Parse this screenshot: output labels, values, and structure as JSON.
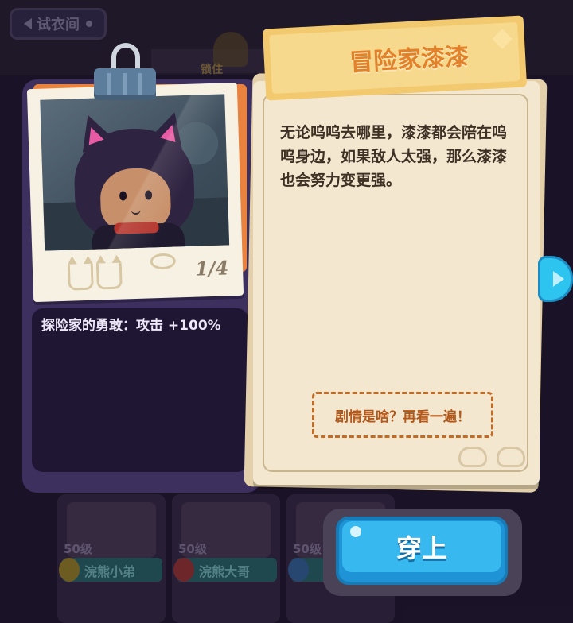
{
  "top": {
    "tryon_label": "试衣间",
    "locked_label": "锁住"
  },
  "card": {
    "name": "冒险家漆漆",
    "page": "1/4",
    "skill": "探险家的勇敢：攻击 +100%",
    "story": "无论呜呜去哪里，漆漆都会陪在呜呜身边，如果敌人太强，那么漆漆也会努力变更强。",
    "replay_label": "剧情是啥？再看一遍！",
    "wear_label": "穿上"
  },
  "background_cards": [
    {
      "level": "50级",
      "name": "浣熊小弟",
      "badge_color": "#a38a2c"
    },
    {
      "level": "50级",
      "name": "浣熊大哥",
      "badge_color": "#a33a3a"
    },
    {
      "level": "50级",
      "name": "",
      "badge_color": "#3a6aa3"
    }
  ],
  "colors": {
    "panel": "#3d2f5e",
    "paper": "#f3e8cf",
    "title": "#e2812a",
    "wear_button": "#37b9f0",
    "next_arrow": "#2dc4ef"
  },
  "icons": {
    "clip": "paperclip-icon",
    "next": "chevron-right-icon"
  }
}
